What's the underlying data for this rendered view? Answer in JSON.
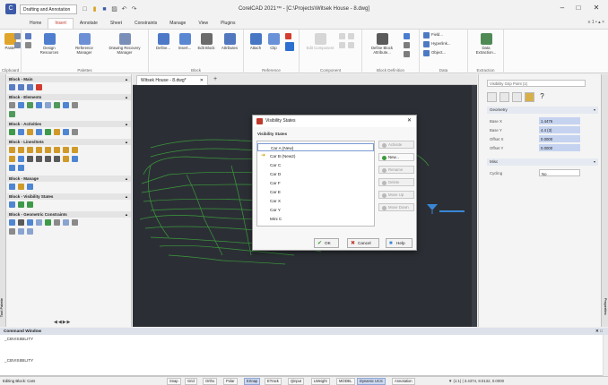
{
  "titlebar": {
    "workspace": "Drafting and Annotation",
    "title": "CorelCAD 2021™ - [C:\\Projects\\Witsek House - 8.dwg]",
    "minimize": "–",
    "maximize": "□",
    "close": "✕"
  },
  "menu": {
    "tabs": [
      "Home",
      "Insert",
      "Annotate",
      "Sheet",
      "Constraints",
      "Manage",
      "View",
      "Plugins"
    ],
    "active_index": 1,
    "help_text": "≡  1  •  ▴  ×"
  },
  "ribbon": {
    "groups": [
      {
        "label": "Clipboard",
        "buttons": [
          "Paste"
        ]
      },
      {
        "label": "Palettes",
        "buttons": [
          "Design Resources",
          "Reference Manager",
          "Drawing Recovery Manager"
        ]
      },
      {
        "label": "Block",
        "buttons": [
          "Define...",
          "Insert...",
          "Edit Block",
          "Attributes"
        ]
      },
      {
        "label": "Reference",
        "buttons": [
          "Attach",
          "Clip"
        ]
      },
      {
        "label": "Component",
        "buttons": [
          "Edit Component"
        ]
      },
      {
        "label": "Block Definition",
        "buttons": [
          "Define Block Attribute..."
        ]
      },
      {
        "label": "Data",
        "buttons": [
          "Field...",
          "Hyperlink...",
          "Object..."
        ]
      },
      {
        "label": "Extraction",
        "buttons": [
          "Data Extraction..."
        ]
      }
    ]
  },
  "palettes": {
    "sections": [
      "Block - Main",
      "Block - Elements",
      "Block - Activities",
      "Block - Lines/Sets",
      "Block - Manage",
      "Block - Visibility States",
      "Block - Geometric Constraints"
    ],
    "nav": "◀◀▶▶",
    "side_label": "Tool Palette"
  },
  "document": {
    "tab": "Witsek House - 8.dwg*",
    "tab_close": "✕",
    "add_tab": "+"
  },
  "dialog": {
    "title": "Visibility States",
    "close": "✕",
    "list_label": "Visibility States",
    "items": [
      "Car A (New)",
      "Car B (New2)",
      "Car C",
      "Car D",
      "Car F",
      "Car E",
      "Car X",
      "Car Y",
      "Mini C"
    ],
    "selected_index": 0,
    "current_index": 1,
    "side_buttons": [
      {
        "label": "Activate",
        "enabled": false,
        "color": "#b9b9b9"
      },
      {
        "label": "New...",
        "enabled": true,
        "color": "#3b9a3b"
      },
      {
        "label": "Rename",
        "enabled": false,
        "color": "#b9b9b9"
      },
      {
        "label": "Delete",
        "enabled": false,
        "color": "#b9b9b9"
      },
      {
        "label": "Move Up",
        "enabled": false,
        "color": "#b9b9b9"
      },
      {
        "label": "Move Down",
        "enabled": false,
        "color": "#b9b9b9"
      }
    ],
    "ok": "OK",
    "cancel": "Cancel",
    "help": "Help"
  },
  "properties": {
    "selector": "Visibility Grip Point (1)",
    "sections": [
      {
        "name": "Geometry",
        "rows": [
          {
            "key": "Base X",
            "value": "1.4476"
          },
          {
            "key": "Base Y",
            "value": "4.4 (3)"
          },
          {
            "key": "Offset X",
            "value": "0.0000"
          },
          {
            "key": "Offset Y",
            "value": "0.0000"
          }
        ]
      },
      {
        "name": "Misc",
        "rows": [
          {
            "key": "Cycling",
            "value": "No"
          }
        ]
      }
    ],
    "side_label": "Properties"
  },
  "command": {
    "title": "Command Window",
    "controls": "✕  □",
    "lines": [
      "_CBVISIBILITY",
      "",
      "",
      "_CBVISIBILITY",
      ""
    ]
  },
  "status": {
    "left": "Editing Block: Cars",
    "toggles": [
      {
        "label": "Snap",
        "on": false
      },
      {
        "label": "Grid",
        "on": false
      },
      {
        "label": "Ortho",
        "on": false
      },
      {
        "label": "Polar",
        "on": false
      },
      {
        "label": "ESnap",
        "on": true
      },
      {
        "label": "ETrack",
        "on": false
      },
      {
        "label": "Qinput",
        "on": false
      },
      {
        "label": "LWeight",
        "on": false
      },
      {
        "label": "MODEL",
        "on": false
      },
      {
        "label": "Dynamic UCS",
        "on": true
      },
      {
        "label": "Annotation",
        "on": false
      }
    ],
    "right": "▼  (1:1)  |  3.4374, 8.0132, 0.0000"
  },
  "colors": {
    "accent": "#c0392b",
    "canvas": "#2b2f35",
    "geometry": "#3c9a3c",
    "grip": "#3a86d6",
    "selection": "#c5d3f0"
  }
}
